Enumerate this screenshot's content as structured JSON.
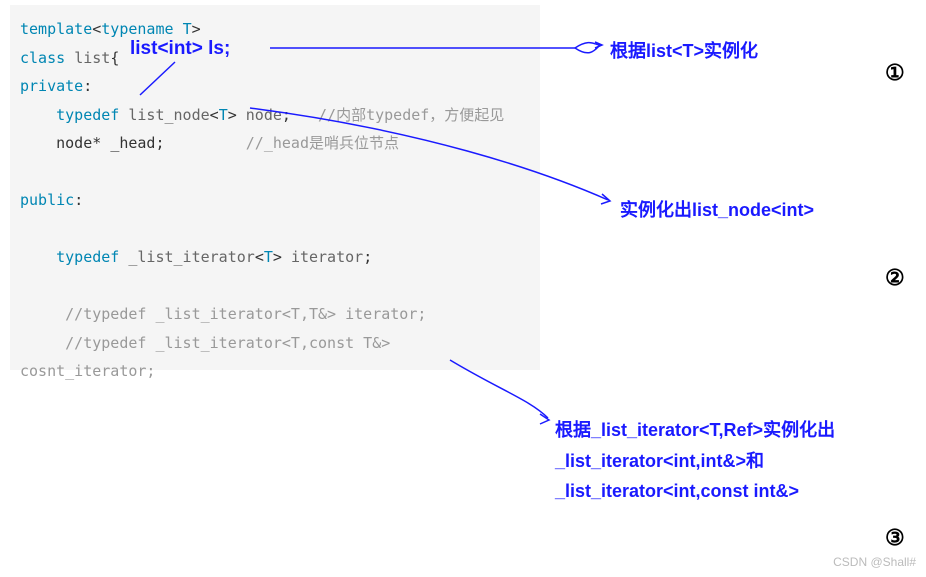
{
  "code": {
    "line1_template": "template",
    "line1_typename": "typename",
    "line1_T": "T",
    "line2_class": "class",
    "line2_list": "list",
    "line3_private": "private",
    "line4_typedef": "typedef",
    "line4_listnode": "list_node",
    "line4_T": "T",
    "line4_node": "node",
    "line4_comment": "//内部typedef，方便起见",
    "line5_nodestar": "node*",
    "line5_head": "_head",
    "line5_comment": "//_head是哨兵位节点",
    "line6_public": "public",
    "line7_typedef": "typedef",
    "line7_iter": "_list_iterator",
    "line7_T": "T",
    "line7_itername": "iterator",
    "line8_comment": "//typedef _list_iterator<T,T&> iterator;",
    "line9_comment": "//typedef _list_iterator<T,const T&> cosnt_iterator;"
  },
  "overlay": {
    "list_int": "list<int> ls;"
  },
  "annotations": {
    "a1": "根据list<T>实例化",
    "a2": "实例化出list_node<int>",
    "a3_l1": "根据_list_iterator<T,Ref>实例化出",
    "a3_l2": "_list_iterator<int,int&>和",
    "a3_l3": "_list_iterator<int,const int&>"
  },
  "numbers": {
    "n1": "①",
    "n2": "②",
    "n3": "③"
  },
  "watermark": "CSDN @Shall#",
  "chart_data": {
    "type": "diagram",
    "description": "C++ template instantiation diagram showing list<T> class definition with arrows pointing to instantiation results",
    "code_lines": [
      "template<typename T>",
      "class list{",
      "private:",
      "    typedef list_node<T> node;   //内部typedef，方便起见",
      "    node* _head;         //_head是哨兵位节点",
      "",
      "public:",
      "",
      "    typedef _list_iterator<T> iterator;",
      "",
      "    //typedef _list_iterator<T,T&> iterator;",
      "    //typedef _list_iterator<T,const T&> cosnt_iterator;"
    ],
    "overlay_label": "list<int> ls;",
    "arrows": [
      {
        "from": "list<int> ls; overlay",
        "to": "根据list<T>实例化",
        "marker": "①"
      },
      {
        "from": "list_node<T> in code",
        "to": "实例化出list_node<int>",
        "marker": "②"
      },
      {
        "from": "_list_iterator<T> in code",
        "to": "根据_list_iterator<T,Ref>实例化出 _list_iterator<int,int&>和 _list_iterator<int,const int&>",
        "marker": "③"
      }
    ]
  }
}
